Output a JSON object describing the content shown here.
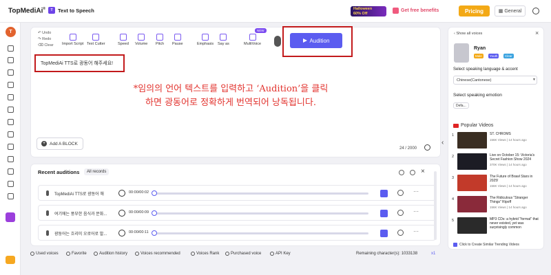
{
  "topbar": {
    "logo": "TopMediAi",
    "logo_sup": "®",
    "product": "Text to Speech",
    "promo_line1": "Halloween",
    "promo_line2": "60% Off",
    "free_benefits": "Get free benefits",
    "pricing": "Pricing",
    "general": "General"
  },
  "sidebar": {
    "avatar_letter": "T"
  },
  "toolbar": {
    "undo": "Undo",
    "redo": "Redo",
    "clear": "Clear",
    "tools": [
      {
        "label": "Import Script"
      },
      {
        "label": "Text Cutter"
      },
      {
        "label": "Speed"
      },
      {
        "label": "Volume"
      },
      {
        "label": "Pitch"
      },
      {
        "label": "Pause"
      },
      {
        "label": "Emphasis"
      },
      {
        "label": "Say as"
      },
      {
        "label": "MultiVoice"
      }
    ],
    "new_badge": "NEW",
    "audition": "Audition"
  },
  "editor": {
    "text": "TopMediAi TTS로 광동어 해주세요!",
    "overlay_line1": "*임의의 언어 텍스트를 입력하고 ‘Audition’을 클릭",
    "overlay_line2": "하면 광동어로 정확하게 번역되어 낭독됩니다.",
    "add_block": "Add A BLOCK",
    "char_count": "24 / 2000"
  },
  "recent": {
    "title": "Recent auditions",
    "all_records": "All records",
    "rows": [
      {
        "text": "TopMediAi TTS로 광동어 해",
        "time": "00:00/00:02"
      },
      {
        "text": "여기에는 풍부한 음식과 문화...",
        "time": "00:00/00:09"
      },
      {
        "text": "광둥어는 흐리미 오로어로 발...",
        "time": "00:00/00:11"
      }
    ]
  },
  "bottombar": {
    "used_voices": "Used voices",
    "favorite": "Favorite",
    "audition_history": "Audition history",
    "voices_recommended": "Voices recommended",
    "voices_rank": "Voices Rank",
    "purchased_voice": "Purchased voice",
    "api_key": "API Key",
    "remaining": "Remaining character(s): 1033138",
    "speed": "x1"
  },
  "rightpanel": {
    "show_all": "Show all voices",
    "voice_name": "Ryan",
    "tags": [
      "Male",
      "Youth",
      "Clear"
    ],
    "tag_colors": [
      "#f3a916",
      "#5b5cf0",
      "#3aa3e0"
    ],
    "speak_label": "Select speaking language & accent",
    "language": "Chinese(Cantonese)",
    "emotion_label": "Select speaking emotion",
    "emotion": "Defa...",
    "popular_videos": "Popular Videos",
    "videos": [
      {
        "num": "1",
        "title": "ST. CHROMS",
        "meta": "156K Views | 14 hours ago",
        "color": "#3a2e22"
      },
      {
        "num": "2",
        "title": "Live on October 15: Victoria's Secret Fashion Show 2024",
        "meta": "370K Views | 14 hours ago",
        "color": "#1c1c24"
      },
      {
        "num": "3",
        "title": "The Future of Brawl Stars in 2025!",
        "meta": "156K Views | 14 hours ago",
        "color": "#c23a2a"
      },
      {
        "num": "4",
        "title": "The Ridiculous \"Stranger Things\" Ripoff",
        "meta": "156K Views | 14 hours ago",
        "color": "#8a2a3a"
      },
      {
        "num": "5",
        "title": "MP3 CDs: a hybrid \"format\" that never existed, yet was surprisingly common",
        "meta": "",
        "color": "#2a2a2a"
      }
    ],
    "create_similar": "Click to Create Similar Trending Videos"
  }
}
